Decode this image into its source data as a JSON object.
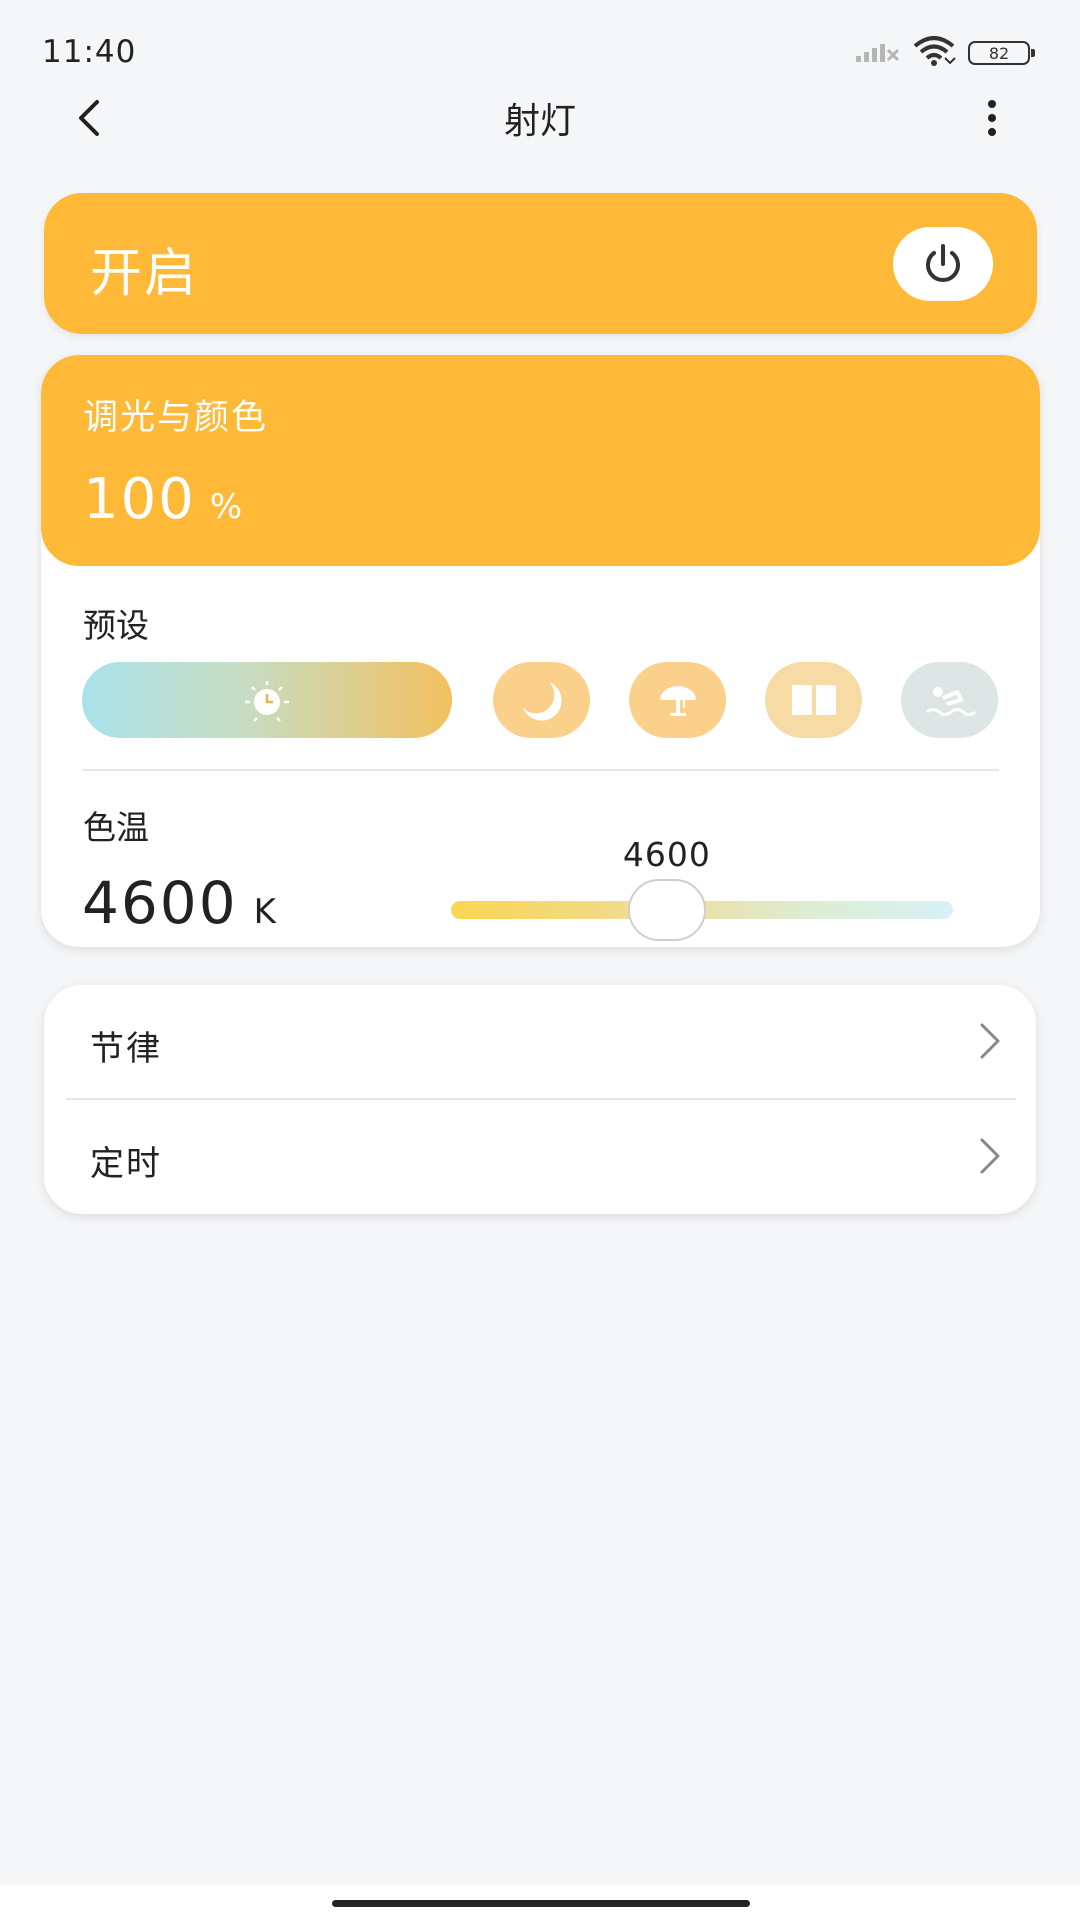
{
  "status_bar": {
    "time": "11:40",
    "battery_level": "82",
    "icons": [
      "signal-icon",
      "wifi-icon",
      "battery-icon"
    ]
  },
  "app_bar": {
    "title": "射灯",
    "back_icon": "chevron-left-icon",
    "more_icon": "more-vertical-icon"
  },
  "power": {
    "label": "开启",
    "icon": "power-icon",
    "color": "#FFB938"
  },
  "dimmer": {
    "title": "调光与颜色",
    "value": "100",
    "unit": "%"
  },
  "presets": {
    "label": "预设",
    "items": [
      {
        "icon": "sun-clock-icon",
        "selected": true
      },
      {
        "icon": "moon-icon",
        "selected": false
      },
      {
        "icon": "lamp-icon",
        "selected": false
      },
      {
        "icon": "book-icon",
        "selected": false
      },
      {
        "icon": "swimmer-icon",
        "selected": false
      }
    ]
  },
  "color_temperature": {
    "label": "色温",
    "value": "4600",
    "unit": "K",
    "slider_value": "4600",
    "slider_fraction": 0.43
  },
  "menu": {
    "items": [
      {
        "label": "节律",
        "icon": "chevron-right-icon"
      },
      {
        "label": "定时",
        "icon": "chevron-right-icon"
      }
    ]
  }
}
